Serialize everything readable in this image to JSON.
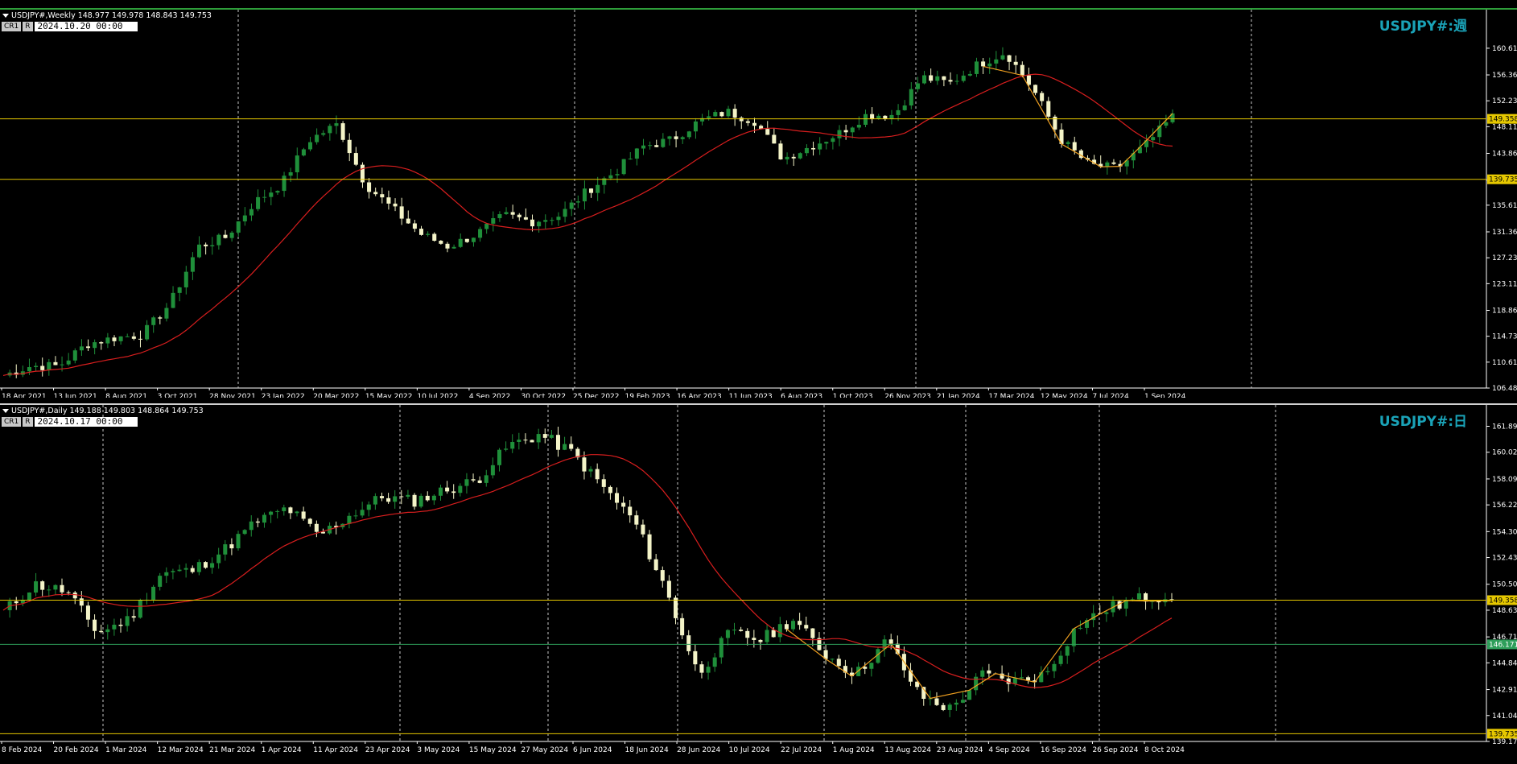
{
  "top": {
    "ohlc_text": "USDJPY#,Weekly  148.977 149.978 148.843 149.753",
    "btn_cr1": "CR1",
    "btn_r": "R",
    "date_value": "2024.10.20 00:00",
    "symbol_label": "USDJPY#:週",
    "price_ticks": [
      "160.610",
      "156.360",
      "152.235",
      "148.110",
      "143.860",
      "139.610",
      "135.610",
      "131.360",
      "127.235",
      "123.110",
      "118.860",
      "114.735",
      "110.610",
      "106.485"
    ],
    "price_range": [
      106.485,
      164.7
    ],
    "hline_values": [
      149.358,
      139.735
    ],
    "hline_labels": [
      "149.358",
      "139.735"
    ],
    "date_labels": [
      "18 Apr 2021",
      "13 Jun 2021",
      "8 Aug 2021",
      "3 Oct 2021",
      "28 Nov 2021",
      "23 Jan 2022",
      "20 Mar 2022",
      "15 May 2022",
      "10 Jul 2022",
      "4 Sep 2022",
      "30 Oct 2022",
      "25 Dec 2022",
      "19 Feb 2023",
      "16 Apr 2023",
      "11 Jun 2023",
      "6 Aug 2023",
      "1 Oct 2023",
      "26 Nov 2023",
      "21 Jan 2024",
      "17 Mar 2024",
      "12 May 2024",
      "7 Jul 2024",
      "1 Sep 2024"
    ]
  },
  "bottom": {
    "ohlc_text": "USDJPY#,Daily  149.188 149.803 148.864 149.753",
    "btn_cr1": "CR1",
    "btn_r": "R",
    "date_value": "2024.10.17 00:00",
    "symbol_label": "USDJPY#:日",
    "price_ticks": [
      "161.890",
      "160.020",
      "158.095",
      "156.225",
      "154.300",
      "152.430",
      "150.505",
      "148.635",
      "146.710",
      "144.840",
      "142.915",
      "141.045",
      "139.175"
    ],
    "price_range": [
      139.175,
      162.5
    ],
    "hline_values": [
      149.358,
      146.171,
      139.735
    ],
    "hline_labels": [
      "149.358",
      "146.171",
      "139.735"
    ],
    "date_labels": [
      "8 Feb 2024",
      "20 Feb 2024",
      "1 Mar 2024",
      "12 Mar 2024",
      "21 Mar 2024",
      "1 Apr 2024",
      "11 Apr 2024",
      "23 Apr 2024",
      "3 May 2024",
      "15 May 2024",
      "27 May 2024",
      "6 Jun 2024",
      "18 Jun 2024",
      "28 Jun 2024",
      "10 Jul 2024",
      "22 Jul 2024",
      "1 Aug 2024",
      "13 Aug 2024",
      "23 Aug 2024",
      "4 Sep 2024",
      "16 Sep 2024",
      "26 Sep 2024",
      "8 Oct 2024"
    ]
  },
  "colors": {
    "bull": "#1f8f3a",
    "bear": "#f4f4c8",
    "ma": "#d81e1e",
    "hline_yellow": "#e6c800",
    "hline_green": "#2e9e5a",
    "zigzag": "#f0a020",
    "symbol": "#1aa3b8"
  }
}
